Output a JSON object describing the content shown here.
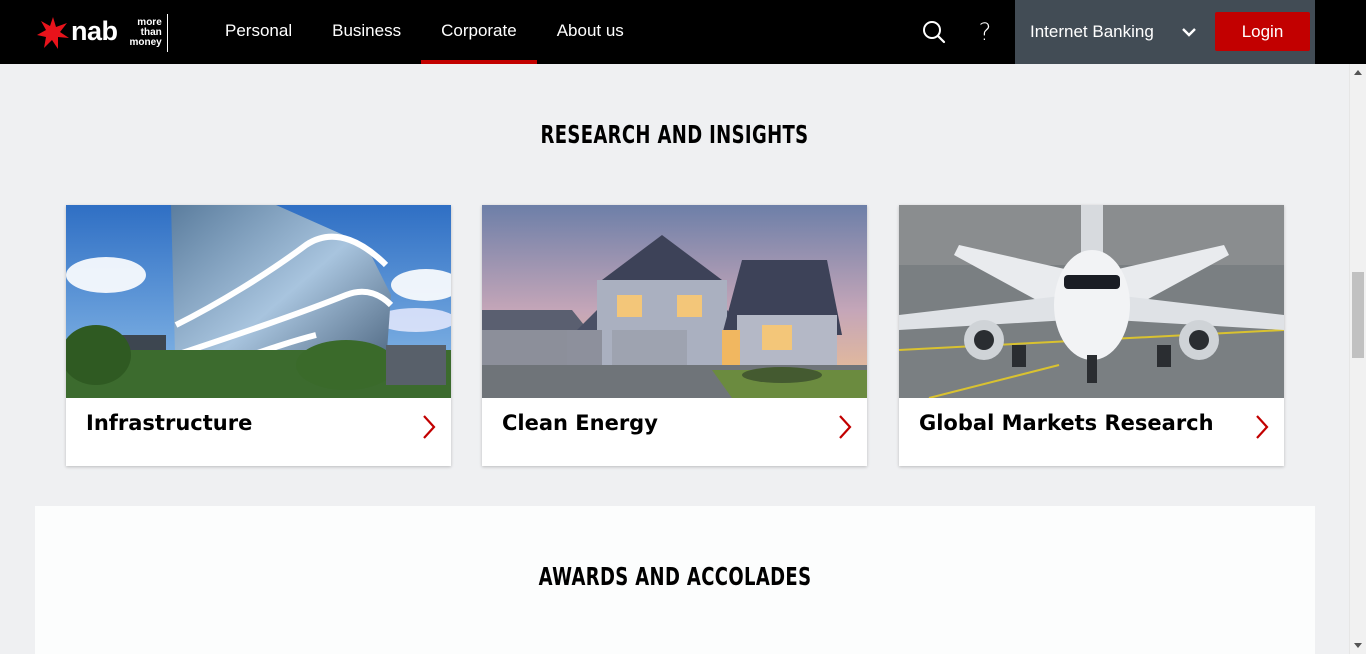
{
  "brand": {
    "name": "nab",
    "tagline": [
      "more",
      "than",
      "money"
    ],
    "accent": "#c20000"
  },
  "nav": {
    "items": [
      {
        "label": "Personal"
      },
      {
        "label": "Business"
      },
      {
        "label": "Corporate",
        "active": true
      },
      {
        "label": "About us"
      }
    ]
  },
  "header": {
    "search_icon": "search-icon",
    "help_icon": "help-icon",
    "help_glyph": "?",
    "banking_select": "Internet Banking",
    "login_label": "Login"
  },
  "research": {
    "title": "RESEARCH AND INSIGHTS",
    "cards": [
      {
        "label": "Infrastructure",
        "image": "modern-glass-building"
      },
      {
        "label": "Clean Energy",
        "image": "suburban-house-at-dusk"
      },
      {
        "label": "Global Markets Research",
        "image": "jet-airliner-on-tarmac"
      }
    ]
  },
  "awards": {
    "title": "AWARDS AND ACCOLADES"
  }
}
